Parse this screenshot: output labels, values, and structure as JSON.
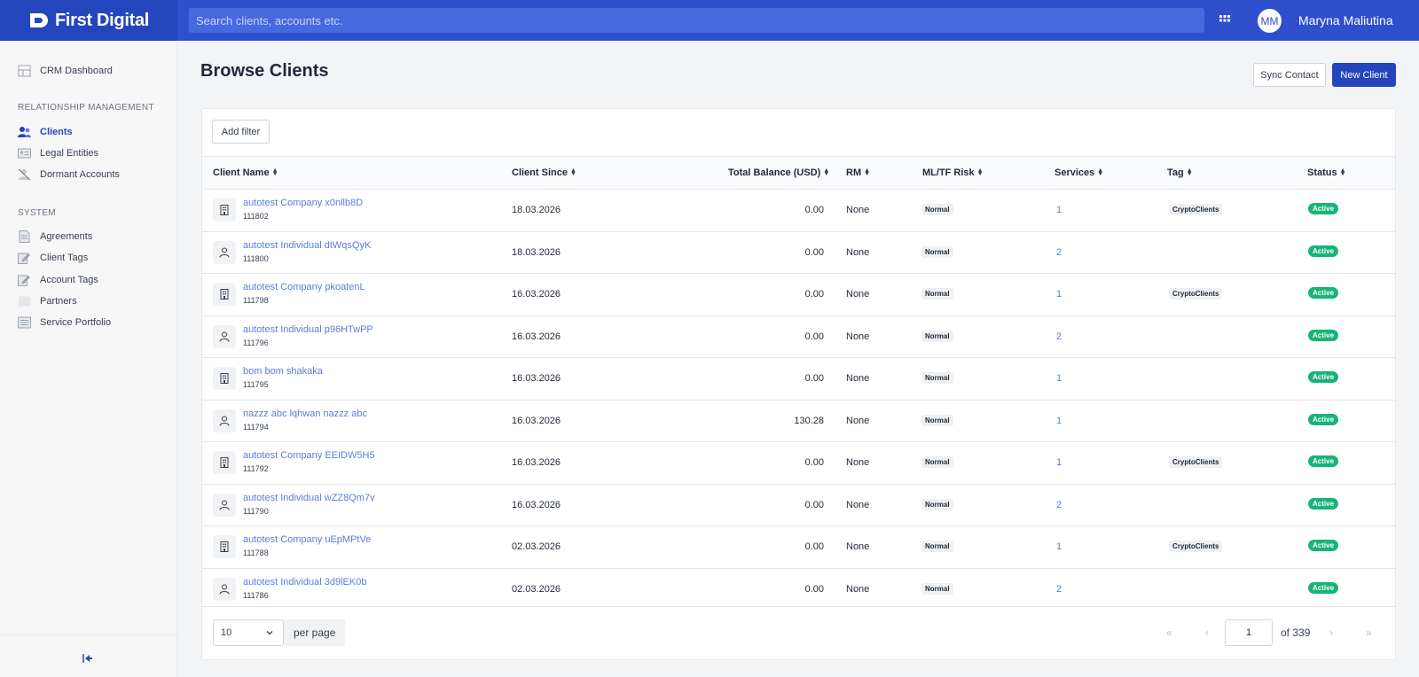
{
  "brand": {
    "name": "First Digital"
  },
  "search": {
    "placeholder": "Search clients, accounts etc."
  },
  "user": {
    "initials": "MM",
    "name": "Maryna Maliutina"
  },
  "sidebar": {
    "dashboard": "CRM Dashboard",
    "section_rm": "RELATIONSHIP MANAGEMENT",
    "rm_items": [
      "Clients",
      "Legal Entities",
      "Dormant Accounts"
    ],
    "section_system": "SYSTEM",
    "system_items": [
      "Agreements",
      "Client Tags",
      "Account Tags",
      "Partners",
      "Service Portfolio"
    ],
    "active_item": "Clients"
  },
  "page": {
    "title": "Browse Clients",
    "sync_label": "Sync Contact",
    "new_label": "New Client",
    "filter_label": "Add filter"
  },
  "table": {
    "columns": [
      "Client Name",
      "Client Since",
      "Total Balance (USD)",
      "RM",
      "ML/TF Risk",
      "Services",
      "Tag",
      "Status"
    ],
    "rows": [
      {
        "type": "company",
        "name": "autotest Company x0nllb8D",
        "id": "111802",
        "since": "18.03.2026",
        "balance": "0.00",
        "rm": "None",
        "risk": "Normal",
        "services": "1",
        "tag": "CryptoClients",
        "status": "Active"
      },
      {
        "type": "individual",
        "name": "autotest Individual dtWqsQyK",
        "id": "111800",
        "since": "18.03.2026",
        "balance": "0.00",
        "rm": "None",
        "risk": "Normal",
        "services": "2",
        "tag": "",
        "status": "Active"
      },
      {
        "type": "company",
        "name": "autotest Company pkoatenL",
        "id": "111798",
        "since": "16.03.2026",
        "balance": "0.00",
        "rm": "None",
        "risk": "Normal",
        "services": "1",
        "tag": "CryptoClients",
        "status": "Active"
      },
      {
        "type": "individual",
        "name": "autotest Individual p96HTwPP",
        "id": "111796",
        "since": "16.03.2026",
        "balance": "0.00",
        "rm": "None",
        "risk": "Normal",
        "services": "2",
        "tag": "",
        "status": "Active"
      },
      {
        "type": "company",
        "name": "bom bom shakaka",
        "id": "111795",
        "since": "16.03.2026",
        "balance": "0.00",
        "rm": "None",
        "risk": "Normal",
        "services": "1",
        "tag": "",
        "status": "Active"
      },
      {
        "type": "individual",
        "name": "nazzz abc lqhwan nazzz abc",
        "id": "111794",
        "since": "16.03.2026",
        "balance": "130.28",
        "rm": "None",
        "risk": "Normal",
        "services": "1",
        "tag": "",
        "status": "Active"
      },
      {
        "type": "company",
        "name": "autotest Company EEIDW5H5",
        "id": "111792",
        "since": "16.03.2026",
        "balance": "0.00",
        "rm": "None",
        "risk": "Normal",
        "services": "1",
        "tag": "CryptoClients",
        "status": "Active"
      },
      {
        "type": "individual",
        "name": "autotest Individual wZZ8Qm7v",
        "id": "111790",
        "since": "16.03.2026",
        "balance": "0.00",
        "rm": "None",
        "risk": "Normal",
        "services": "2",
        "tag": "",
        "status": "Active"
      },
      {
        "type": "company",
        "name": "autotest Company uEpMPtVe",
        "id": "111788",
        "since": "02.03.2026",
        "balance": "0.00",
        "rm": "None",
        "risk": "Normal",
        "services": "1",
        "tag": "CryptoClients",
        "status": "Active"
      },
      {
        "type": "individual",
        "name": "autotest Individual 3d9lEK0b",
        "id": "111786",
        "since": "02.03.2026",
        "balance": "0.00",
        "rm": "None",
        "risk": "Normal",
        "services": "2",
        "tag": "",
        "status": "Active"
      }
    ]
  },
  "pagination": {
    "per_page": "10",
    "per_page_label": "per page",
    "page": "1",
    "of_label": "of 339"
  },
  "colors": {
    "brand": "#2545bd",
    "topbar": "#2f4fcc",
    "link": "#5b7be0",
    "active": "#18b477"
  }
}
